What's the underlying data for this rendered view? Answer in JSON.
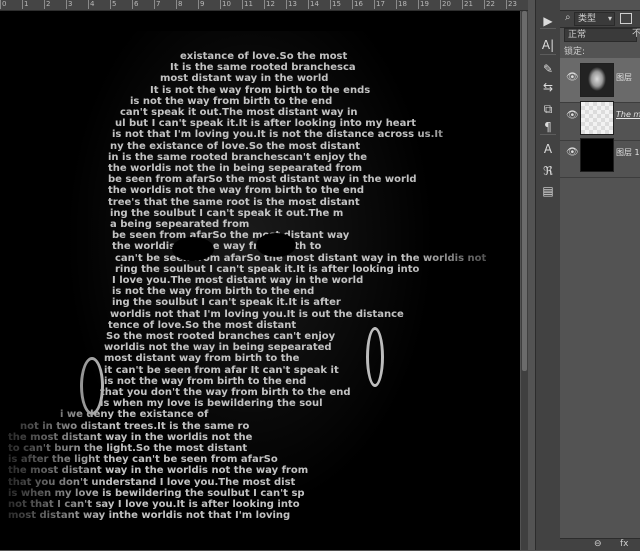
{
  "ruler": {
    "ticks": [
      "0",
      "1",
      "2",
      "3",
      "4",
      "5",
      "6",
      "7",
      "8",
      "9",
      "10",
      "11",
      "12",
      "13",
      "14",
      "15",
      "16",
      "17",
      "18",
      "19",
      "20",
      "21",
      "22",
      "23"
    ]
  },
  "canvas": {
    "text_lines": [
      "existance of love.So the most",
      "It is the same rooted branchesca",
      "most distant way in the world",
      "It is not the way from birth to the ends",
      "is not the way from birth to the end",
      "can't speak it out.The most distant way in",
      "ul but I can't speak it.It is after looking into my heart",
      "is not that I'm loving you.It is not the distance across us.It",
      "ny the existance of love.So the most distant",
      "in is the same rooted branchescan't enjoy the",
      "the worldis not the in being sepearated from",
      "be seen from afarSo the most distant way in the world",
      "the worldis not the way from birth to the end",
      "tree's that the same root is the most distant",
      "ing the soulbut I can't speak it out.The m",
      "a being sepearated from",
      "be seen from afarSo the most distant way",
      "the worldis not the way from birth to",
      "can't be seen from afarSo the most distant way in the worldis not",
      "ring the soulbut I can't speak it.It is after looking into",
      "I love you.The most distant way in the world",
      "is not the way from birth to the end",
      "ing the soulbut I can't speak it.It is after",
      "worldis not that I'm loving you.It is out the distance",
      "tence of love.So the most distant",
      "So the most rooted branches can't enjoy",
      "worldis not the way in being sepearated",
      "most distant way from birth to the",
      "it can't be seen from afar It can't speak it",
      "is not the way from birth to the end",
      "that you don't the way from birth to the end",
      "is when my love is bewildering the soul",
      "i we deny the existance of",
      "not in two distant trees.It is the same ro",
      "the most distant way in the worldis not the",
      "to can't burn the light.So the most distant",
      "is after the light they can't be seen from afarSo",
      "the most distant way in the worldis not the way from",
      "that you don't understand I love you.The most dist",
      "is when my love is bewildering the soulbut I can't sp",
      "not that I can't say I love you.It is after looking into",
      "most distant way inthe worldis not that I'm loving"
    ]
  },
  "tools": [
    {
      "name": "play-icon",
      "glyph": "▶"
    },
    {
      "name": "character-panel-icon",
      "glyph": "A|"
    },
    {
      "name": "brush-icon",
      "glyph": "✎"
    },
    {
      "name": "adjustments-icon",
      "glyph": "⇆"
    },
    {
      "name": "clone-source-icon",
      "glyph": "⧉"
    },
    {
      "name": "paragraph-icon",
      "glyph": "¶"
    },
    {
      "name": "character-style-icon",
      "glyph": "A"
    },
    {
      "name": "paragraph-style-icon",
      "glyph": "ℜ"
    },
    {
      "name": "notes-icon",
      "glyph": "▤"
    }
  ],
  "layers_panel": {
    "filter_kind": "类型",
    "blend_mode": "正常",
    "opacity_label": "不",
    "lock_label": "锁定:",
    "layers": [
      {
        "name": "图层",
        "selected": true,
        "thumb": "portrait"
      },
      {
        "name": "The mos",
        "selected": false,
        "thumb": "checker"
      },
      {
        "name": "图层 1",
        "selected": false,
        "thumb": "black"
      }
    ],
    "footer_fx": "fx"
  },
  "colors": {
    "panel_bg": "#535353",
    "dark_bg": "#424242",
    "canvas_bg": "#000000",
    "selected_layer": "#6a6a6a"
  }
}
